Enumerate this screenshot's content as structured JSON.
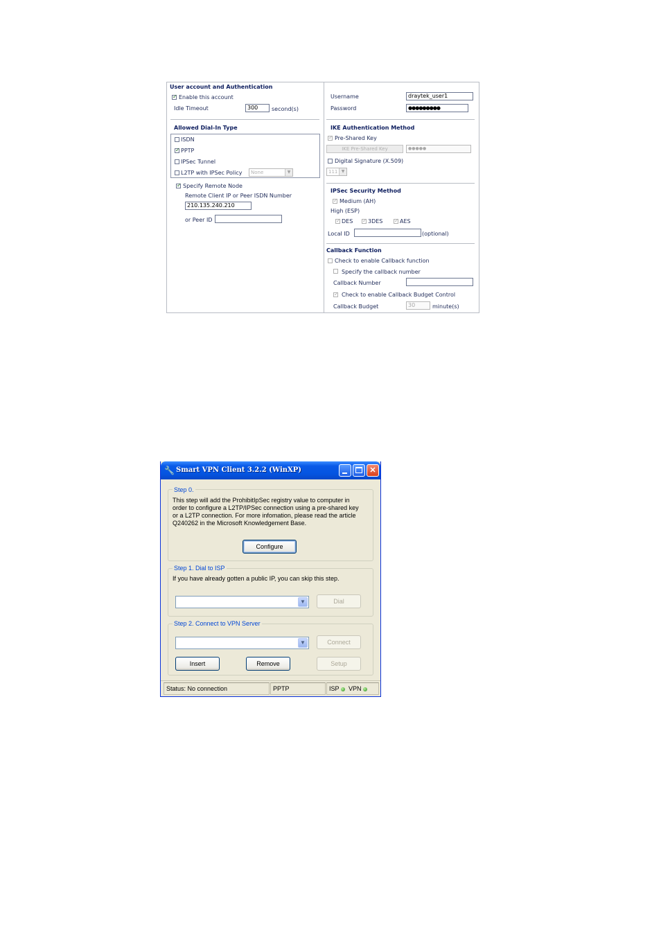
{
  "router": {
    "user_section": {
      "title": "User account and Authentication",
      "enable_label": "Enable this account",
      "enable_checked": true,
      "idle_label": "Idle Timeout",
      "idle_value": "300",
      "idle_unit": "second(s)"
    },
    "dialin": {
      "title": "Allowed Dial-In Type",
      "isdn": "ISDN",
      "pptp": "PPTP",
      "ipsec": "IPSec Tunnel",
      "l2tp": "L2TP with IPSec Policy",
      "l2tp_policy": "None"
    },
    "remote": {
      "specify_label": "Specify Remote Node",
      "client_label": "Remote Client IP or Peer ISDN Number",
      "client_value": "210.135.240.210",
      "peer_label": "or Peer ID",
      "peer_value": ""
    },
    "account": {
      "username_label": "Username",
      "username_value": "draytek_user1",
      "password_label": "Password",
      "password_value": "●●●●●●●●●"
    },
    "ike": {
      "title": "IKE Authentication Method",
      "psk_label": "Pre-Shared Key",
      "psk_button": "IKE Pre-Shared Key",
      "psk_value": "●●●●●",
      "digsig_label": "Digital Signature (X.509)",
      "digsig_select": "111"
    },
    "ipsec_security": {
      "title": "IPSec Security Method",
      "medium": "Medium (AH)",
      "high": "High (ESP)",
      "des": "DES",
      "tdes": "3DES",
      "aes": "AES",
      "local_id_label": "Local ID",
      "local_id_value": "",
      "optional": "(optional)"
    },
    "callback": {
      "title": "Callback Function",
      "enable_label": "Check to enable Callback function",
      "specify_label": "Specify the callback number",
      "number_label": "Callback Number",
      "number_value": "",
      "budget_check_label": "Check to enable Callback Budget Control",
      "budget_label": "Callback Budget",
      "budget_value": "30",
      "budget_unit": "minute(s)"
    }
  },
  "vpn_client": {
    "title": "Smart VPN Client  3.2.2 (WinXP)",
    "step0": {
      "label": "Step 0.",
      "line1": "This step will add the ProhibitIpSec registry value to computer in",
      "line2": "order to configure a L2TP/IPSec connection using a pre-shared key",
      "line3": "or a L2TP connection. For more infomation, please read the article",
      "line4": "Q240262 in the Microsoft Knowledgement Base.",
      "configure_button": "Configure"
    },
    "step1": {
      "label": "Step 1. Dial to ISP",
      "text": "If you have already gotten a public IP, you can skip this step.",
      "dial_button": "Dial"
    },
    "step2": {
      "label": "Step 2. Connect to VPN Server",
      "connect_button": "Connect",
      "insert_button": "Insert",
      "remove_button": "Remove",
      "setup_button": "Setup"
    },
    "status": {
      "status_text": "Status: No connection",
      "protocol": "PPTP",
      "isp": "ISP",
      "vpn": "VPN"
    }
  }
}
